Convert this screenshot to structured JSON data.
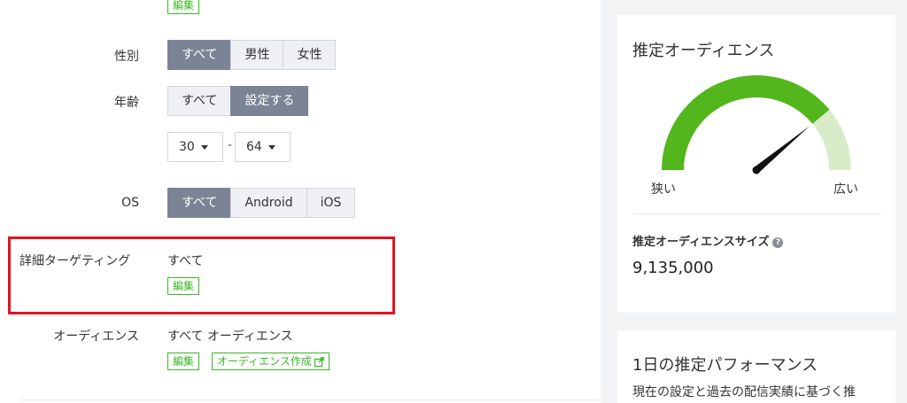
{
  "top_edit_label": "編集",
  "gender": {
    "label": "性別",
    "options": [
      "すべて",
      "男性",
      "女性"
    ],
    "selected": "すべて"
  },
  "age": {
    "label": "年齢",
    "options": [
      "すべて",
      "設定する"
    ],
    "selected": "設定する",
    "min": "30",
    "separator": "-",
    "max": "64"
  },
  "os": {
    "label": "OS",
    "options": [
      "すべて",
      "Android",
      "iOS"
    ],
    "selected": "すべて"
  },
  "detailed_targeting": {
    "label": "詳細ターゲティング",
    "value": "すべて",
    "edit_label": "編集"
  },
  "audience": {
    "label": "オーディエンス",
    "value": "すべて オーディエンス",
    "edit_label": "編集",
    "create_label": "オーディエンス作成"
  },
  "estimated_audience": {
    "title": "推定オーディエンス",
    "narrow_label": "狭い",
    "wide_label": "広い",
    "gauge_level_percent": 78,
    "size_label": "推定オーディエンスサイズ",
    "size_value": "9,135,000",
    "colors": {
      "filled": "#52b61c",
      "remaining": "#d8ecc9",
      "needle": "#111111"
    }
  },
  "daily_performance": {
    "title": "1日の推定パフォーマンス",
    "description": "現在の設定と過去の配信実績に基づく推"
  },
  "colors": {
    "accent_green": "#39b824",
    "segment_active": "#7a8494",
    "highlight_red": "#e0141e"
  }
}
